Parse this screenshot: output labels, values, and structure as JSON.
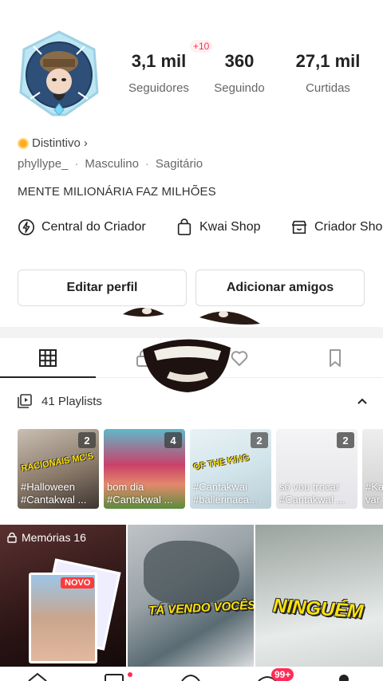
{
  "profile": {
    "stats": [
      {
        "value": "3,1 mil",
        "label": "Seguidores"
      },
      {
        "value": "360",
        "label": "Seguindo"
      },
      {
        "value": "27,1 mil",
        "label": "Curtidas"
      }
    ],
    "new_followers_badge": "+10",
    "badge_label": "Distintivo",
    "badge_chevron": "›",
    "username": "phyllype_",
    "gender": "Masculino",
    "zodiac": "Sagitário",
    "meta_separator": "·",
    "bio": "MENTE MILIONÁRIA FAZ MILHÕES"
  },
  "shortcuts": [
    {
      "label": "Central do Criador",
      "icon": "lightning-circle-icon"
    },
    {
      "label": "Kwai Shop",
      "icon": "shopping-bag-icon"
    },
    {
      "label": "Criador Shop",
      "icon": "storefront-icon"
    }
  ],
  "buttons": {
    "edit_profile": "Editar perfil",
    "add_friends": "Adicionar amigos"
  },
  "tabs": [
    {
      "name": "grid",
      "icon": "grid-icon",
      "active": true
    },
    {
      "name": "private",
      "icon": "lock-icon",
      "active": false
    },
    {
      "name": "likes",
      "icon": "heart-icon",
      "active": false
    },
    {
      "name": "saved",
      "icon": "bookmark-icon",
      "active": false
    }
  ],
  "playlists": {
    "header": "41 Playlists",
    "items": [
      {
        "count": "2",
        "title": "#Halloween\n#Cantakwal ...",
        "sticker": "RACIONAIS MC'S",
        "bg": "#7a6a5a"
      },
      {
        "count": "4",
        "title": "bom dia\n#Cantakwal ...",
        "sticker": "",
        "bg": "#5fb9c9"
      },
      {
        "count": "2",
        "title": "#Cantakwai\n#ballerinaca...",
        "sticker": "OF THE KING",
        "bg": "#cfe3ea"
      },
      {
        "count": "2",
        "title": "só vou trocar\n#Cantakwal ...",
        "sticker": "",
        "bg": "#e9e9ec"
      },
      {
        "count": "",
        "title": "#Ka\nvar",
        "sticker": "",
        "bg": "#dcdcdc"
      }
    ]
  },
  "grid": {
    "memories_label": "Memórias 16",
    "novo_label": "NOVO",
    "video2_text": "TÁ VENDO VOCÊS",
    "video3_text": "NINGUÉM"
  },
  "bottom_nav": {
    "notification_badge": "99+"
  },
  "colors": {
    "accent": "#ff2c55",
    "badge_gold": "#ffb020",
    "sticker_yellow": "#ffe20a"
  }
}
